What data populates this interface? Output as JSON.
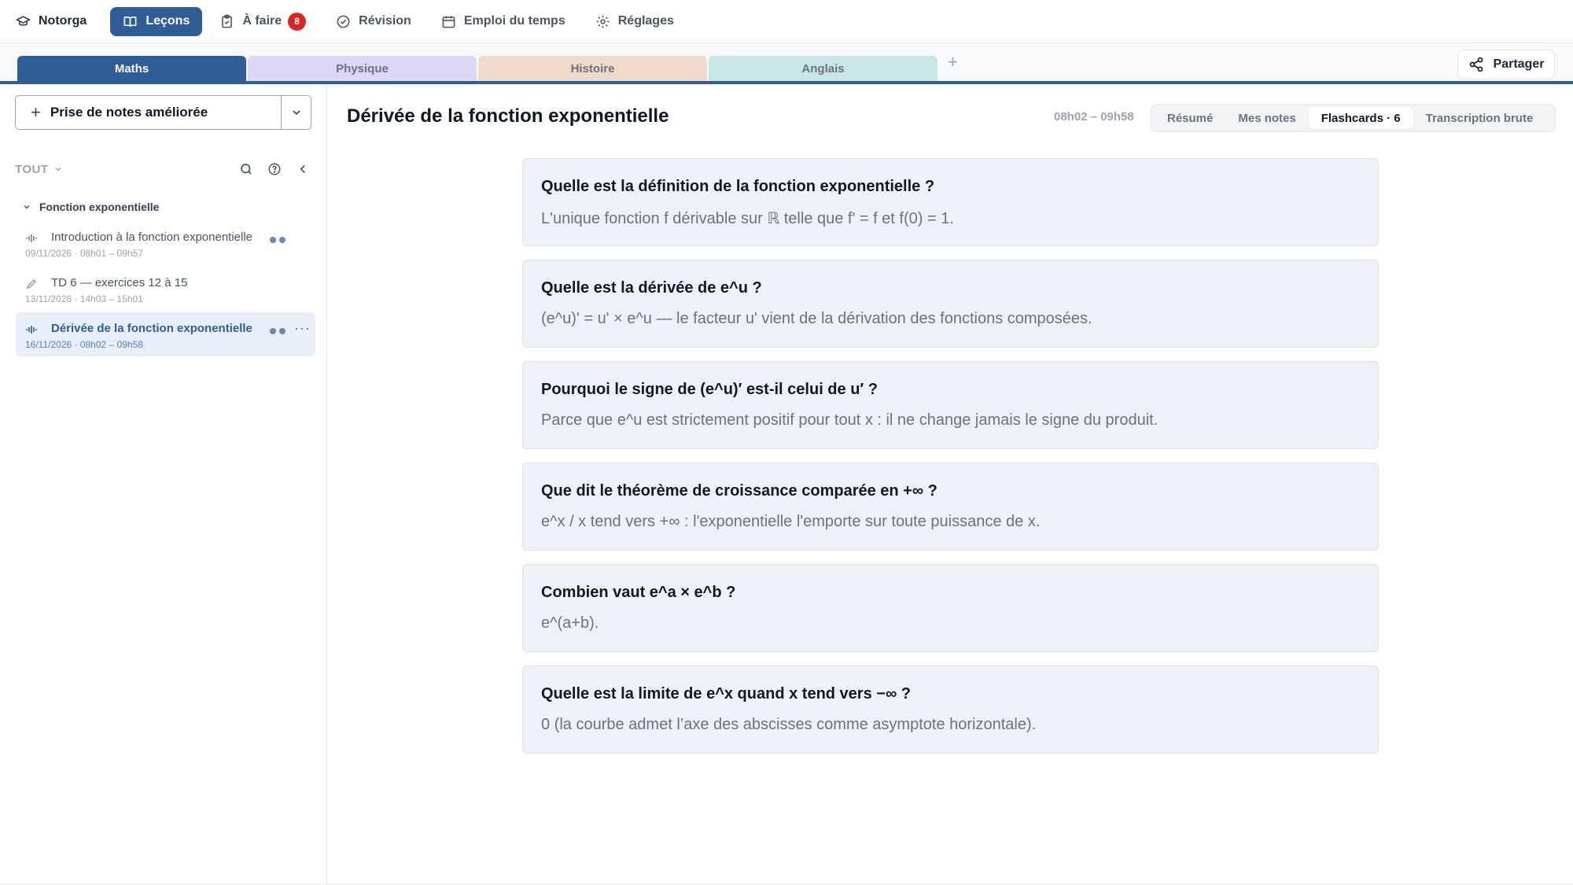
{
  "nav": {
    "brand": "Notorga",
    "items": [
      {
        "label": "Leçons"
      },
      {
        "label": "À faire",
        "badge": "8"
      },
      {
        "label": "Révision"
      },
      {
        "label": "Emploi du temps"
      },
      {
        "label": "Réglages"
      }
    ]
  },
  "subject_tabs": [
    {
      "label": "Maths",
      "color": "#2f5d96"
    },
    {
      "label": "Physique",
      "color": "#dcd6f7"
    },
    {
      "label": "Histoire",
      "color": "#f1d9cc"
    },
    {
      "label": "Anglais",
      "color": "#c8e6e6"
    }
  ],
  "add_tab_label": "+",
  "share_label": "Partager",
  "sidebar": {
    "new_note_label": "Prise de notes améliorée",
    "filter_label": "TOUT",
    "folder_name": "Fonction exponentielle",
    "lessons": [
      {
        "title": "Introduction à la fonction exponentielle",
        "date": "09/11/2026 · 08h01 – 09h57",
        "icon": "audio-wave-icon"
      },
      {
        "title": "TD 6 — exercices 12 à 15",
        "date": "13/11/2026 · 14h03 – 15h01",
        "icon": "pencil-icon"
      },
      {
        "title": "Dérivée de la fonction exponentielle",
        "date": "16/11/2026 · 08h02 – 09h58",
        "icon": "audio-wave-icon"
      }
    ]
  },
  "main": {
    "title": "Dérivée de la fonction exponentielle",
    "time_range": "08h02 – 09h58",
    "view_tabs": [
      {
        "label": "Résumé"
      },
      {
        "label": "Mes notes"
      },
      {
        "label": "Flashcards · 6"
      },
      {
        "label": "Transcription brute"
      }
    ],
    "flashcards": [
      {
        "q": "Quelle est la définition de la fonction exponentielle ?",
        "a": "L'unique fonction f dérivable sur ℝ telle que f' = f et f(0) = 1."
      },
      {
        "q": "Quelle est la dérivée de e^u ?",
        "a": "(e^u)' = u' × e^u — le facteur u' vient de la dérivation des fonctions composées."
      },
      {
        "q": "Pourquoi le signe de (e^u)′ est-il celui de u′ ?",
        "a": "Parce que e^u est strictement positif pour tout x : il ne change jamais le signe du produit."
      },
      {
        "q": "Que dit le théorème de croissance comparée en +∞ ?",
        "a": "e^x / x tend vers +∞ : l'exponentielle l'emporte sur toute puissance de x."
      },
      {
        "q": "Combien vaut e^a × e^b ?",
        "a": "e^(a+b)."
      },
      {
        "q": "Quelle est la limite de e^x quand x tend vers −∞ ?",
        "a": "0 (la courbe admet l’axe des abscisses comme asymptote horizontale)."
      }
    ]
  },
  "colors": {
    "accent": "#2f5d96",
    "badge": "#dc2626",
    "card_bg": "#eef1f7"
  }
}
